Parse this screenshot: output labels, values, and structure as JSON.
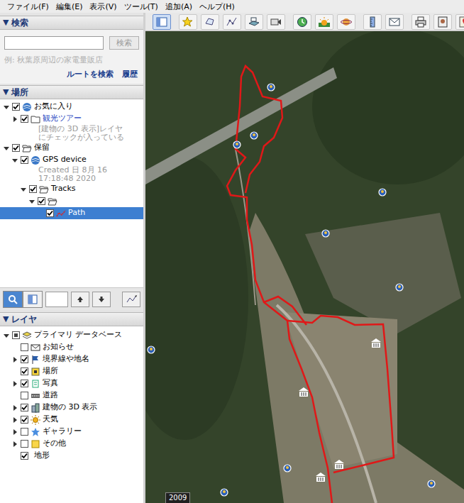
{
  "menu": [
    "ファイル(F)",
    "編集(E)",
    "表示(V)",
    "ツール(T)",
    "追加(A)",
    "ヘルプ(H)"
  ],
  "search": {
    "arrow": "▼",
    "header": "検索",
    "expanded": true,
    "value": "",
    "button": "検索",
    "example": "例: 秋葉原周辺の家電量販店",
    "links": [
      "ルートを検索",
      "履歴"
    ]
  },
  "places": {
    "arrow": "▼",
    "header": "場所",
    "expanded": true,
    "items": [
      {
        "label": "お気に入り",
        "depth": 0,
        "expandable": true,
        "expanded": true,
        "checked": true,
        "kind": "globe",
        "link": false,
        "selected": false,
        "notes": []
      },
      {
        "label": "観光ツアー",
        "depth": 1,
        "expandable": true,
        "expanded": false,
        "checked": true,
        "kind": "folder",
        "link": true,
        "selected": false,
        "notes": [
          "[建物の 3D 表示]レイヤ",
          "にチェックが入っている"
        ]
      },
      {
        "label": "保留",
        "depth": 0,
        "expandable": true,
        "expanded": true,
        "checked": true,
        "kind": "folderopen",
        "link": false,
        "selected": false,
        "notes": []
      },
      {
        "label": "GPS device",
        "depth": 1,
        "expandable": true,
        "expanded": true,
        "checked": true,
        "kind": "globe",
        "link": false,
        "selected": false,
        "notes": [
          "Created 日 8月 16",
          "17:18:48 2020"
        ]
      },
      {
        "label": "Tracks",
        "depth": 2,
        "expandable": true,
        "expanded": true,
        "checked": true,
        "kind": "folderopen",
        "link": false,
        "selected": false,
        "notes": []
      },
      {
        "label": "",
        "depth": 3,
        "expandable": true,
        "expanded": true,
        "checked": true,
        "kind": "folderopen",
        "link": false,
        "selected": false,
        "notes": []
      },
      {
        "label": "Path",
        "depth": 4,
        "expandable": false,
        "expanded": false,
        "checked": true,
        "kind": "track",
        "link": false,
        "selected": true,
        "notes": []
      }
    ]
  },
  "panel_tools": {
    "buttons": [
      {
        "kind": "search",
        "selected": true
      },
      {
        "kind": "layers",
        "selected": false
      }
    ],
    "value": ""
  },
  "layers": {
    "arrow": "▼",
    "header": "レイヤ",
    "expanded": true,
    "items": [
      {
        "label": "プライマリ データベース",
        "depth": 0,
        "expandable": true,
        "expanded": true,
        "checked": true,
        "partial": true,
        "kind": "stack"
      },
      {
        "label": "お知らせ",
        "depth": 1,
        "expandable": false,
        "expanded": false,
        "checked": false,
        "partial": false,
        "kind": "envelope"
      },
      {
        "label": "境界線や地名",
        "depth": 1,
        "expandable": true,
        "expanded": false,
        "checked": true,
        "partial": false,
        "kind": "flag"
      },
      {
        "label": "場所",
        "depth": 1,
        "expandable": false,
        "expanded": false,
        "checked": true,
        "partial": false,
        "kind": "place"
      },
      {
        "label": "写真",
        "depth": 1,
        "expandable": true,
        "expanded": false,
        "checked": true,
        "partial": false,
        "kind": "photo"
      },
      {
        "label": "道路",
        "depth": 1,
        "expandable": false,
        "expanded": false,
        "checked": false,
        "partial": false,
        "kind": "road"
      },
      {
        "label": "建物の 3D 表示",
        "depth": 1,
        "expandable": true,
        "expanded": false,
        "checked": true,
        "partial": false,
        "kind": "building"
      },
      {
        "label": "天気",
        "depth": 1,
        "expandable": true,
        "expanded": false,
        "checked": true,
        "partial": false,
        "kind": "sun"
      },
      {
        "label": "ギャラリー",
        "depth": 1,
        "expandable": true,
        "expanded": false,
        "checked": false,
        "partial": false,
        "kind": "star"
      },
      {
        "label": "その他",
        "depth": 1,
        "expandable": true,
        "expanded": false,
        "checked": false,
        "partial": false,
        "kind": "note"
      },
      {
        "label": "地形",
        "depth": 1,
        "expandable": false,
        "expanded": false,
        "checked": true,
        "partial": false,
        "kind": "none"
      }
    ]
  },
  "toolbar": [
    {
      "kind": "sidebar",
      "selected": true
    },
    {
      "kind": "placemark",
      "selected": false
    },
    {
      "kind": "polygon",
      "selected": false
    },
    {
      "kind": "path",
      "selected": false
    },
    {
      "kind": "overlay",
      "selected": false
    },
    {
      "kind": "tour",
      "selected": false
    },
    {
      "kind": "history",
      "selected": false
    },
    {
      "kind": "sunlight",
      "selected": false
    },
    {
      "kind": "planet",
      "selected": false
    },
    {
      "kind": "ruler",
      "selected": false
    },
    {
      "kind": "email",
      "selected": false
    },
    {
      "kind": "print",
      "selected": false
    },
    {
      "kind": "savephoto",
      "selected": false
    },
    {
      "kind": "maps",
      "selected": false
    }
  ],
  "map": {
    "year": "2009"
  }
}
